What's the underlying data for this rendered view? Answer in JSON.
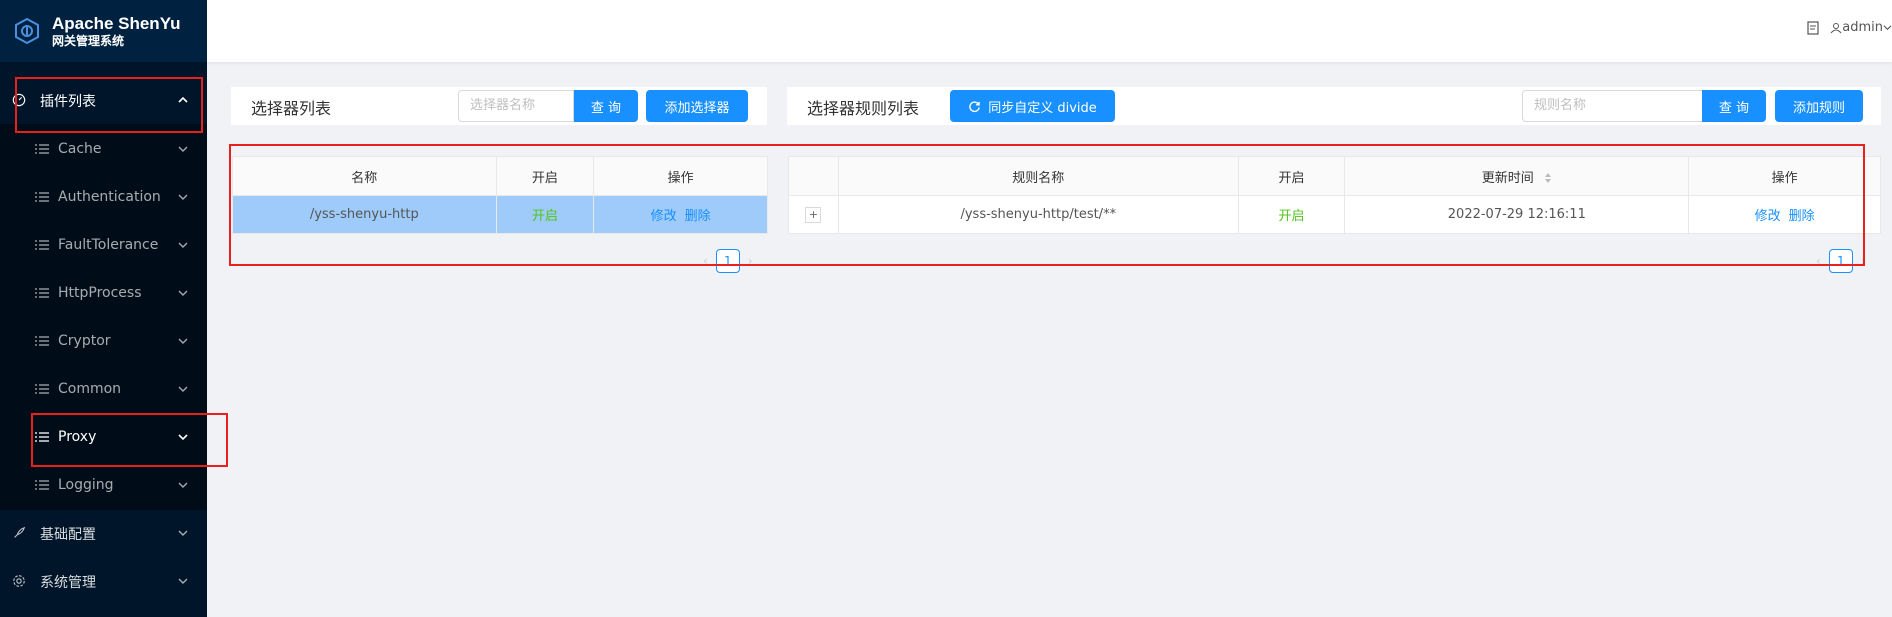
{
  "app": {
    "title": "Apache ShenYu",
    "subtitle": "网关管理系统"
  },
  "header": {
    "user": "admin"
  },
  "sidebar": {
    "plugin_list": "插件列表",
    "items": [
      {
        "label": "Cache"
      },
      {
        "label": "Authentication"
      },
      {
        "label": "FaultTolerance"
      },
      {
        "label": "HttpProcess"
      },
      {
        "label": "Cryptor"
      },
      {
        "label": "Common"
      },
      {
        "label": "Proxy"
      },
      {
        "label": "Logging"
      }
    ],
    "basic_config": "基础配置",
    "system_manage": "系统管理"
  },
  "selector_panel": {
    "title": "选择器列表",
    "search_placeholder": "选择器名称",
    "query_button": "查 询",
    "add_button": "添加选择器",
    "columns": [
      "名称",
      "开启",
      "操作"
    ],
    "rows": [
      {
        "name": "/yss-shenyu-http",
        "enabled": "开启",
        "edit": "修改",
        "delete": "删除"
      }
    ],
    "page": "1"
  },
  "rule_panel": {
    "title": "选择器规则列表",
    "sync_button": "同步自定义 divide",
    "search_placeholder": "规则名称",
    "query_button": "查 询",
    "add_button": "添加规则",
    "columns": [
      "",
      "规则名称",
      "开启",
      "更新时间",
      "操作"
    ],
    "rows": [
      {
        "expand": "+",
        "name": "/yss-shenyu-http/test/**",
        "enabled": "开启",
        "updated": "2022-07-29 12:16:11",
        "edit": "修改",
        "delete": "删除"
      }
    ],
    "page": "1"
  },
  "colors": {
    "sidebar_bg": "#001529",
    "primary": "#1890ff",
    "success": "#52c41a",
    "highlight": "#e8211e"
  }
}
